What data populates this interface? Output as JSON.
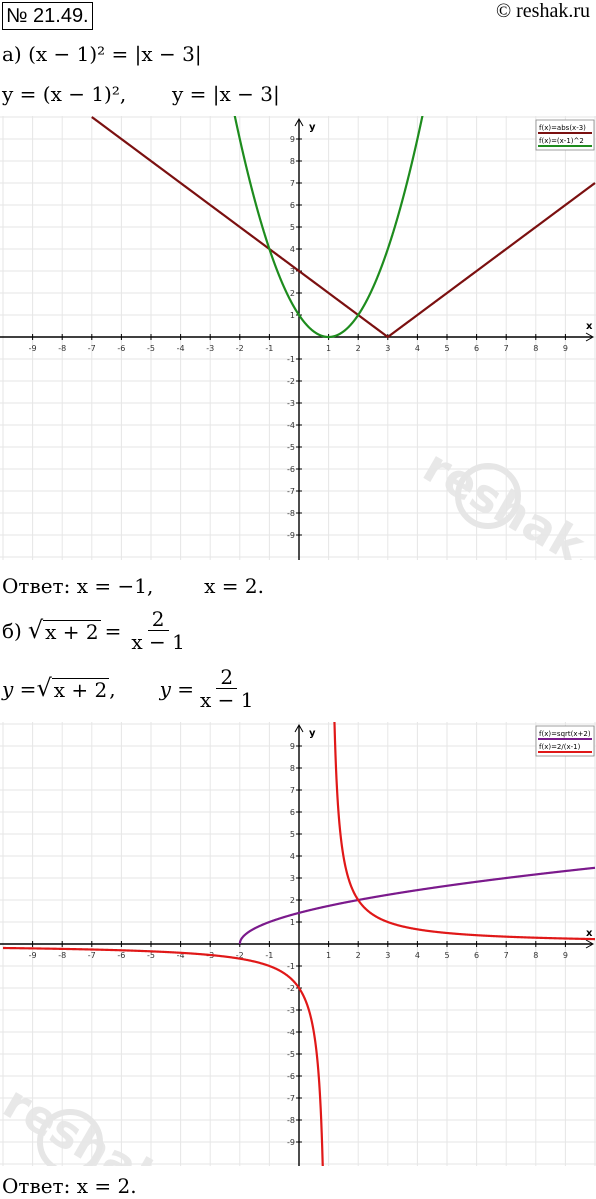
{
  "problem_number": "№ 21.49.",
  "site": "© reshak.ru",
  "watermark": "reshak.ru",
  "part_a": {
    "label": "а)",
    "equation": "(x − 1)² = |x − 3|",
    "functions_line": [
      "y = (x − 1)²,",
      "y = |x − 3|"
    ],
    "answer_label": "Ответ:",
    "answer": "x = −1,        x = 2."
  },
  "part_b": {
    "label": "б)",
    "eq_left": "x + 2",
    "eq_num": "2",
    "eq_den": "x − 1",
    "func1_radicand": "x + 2",
    "func2_num": "2",
    "func2_den": "x − 1",
    "answer_label": "Ответ:",
    "answer": "x = 2."
  },
  "chart_data": [
    {
      "type": "line",
      "title": "",
      "xlabel": "x",
      "ylabel": "y",
      "xlim": [
        -10,
        10
      ],
      "ylim": [
        -10,
        10
      ],
      "grid": true,
      "legend_position": "top-right",
      "x_ticks": [
        -9,
        -8,
        -7,
        -6,
        -5,
        -4,
        -3,
        -2,
        -1,
        1,
        2,
        3,
        4,
        5,
        6,
        7,
        8,
        9
      ],
      "y_ticks": [
        -9,
        -8,
        -7,
        -6,
        -5,
        -4,
        -3,
        -2,
        -1,
        1,
        2,
        3,
        4,
        5,
        6,
        7,
        8,
        9
      ],
      "series": [
        {
          "name": "f(x)=abs(x-3)",
          "color": "#7b1010",
          "expr": "abs(x-3)",
          "domain": [
            -7,
            10
          ]
        },
        {
          "name": "f(x)=(x-1)^2",
          "color": "#1e8c1e",
          "expr": "(x-1)^2",
          "domain": [
            -2.2,
            4.2
          ]
        }
      ]
    },
    {
      "type": "line",
      "title": "",
      "xlabel": "x",
      "ylabel": "y",
      "xlim": [
        -10,
        10
      ],
      "ylim": [
        -10,
        10
      ],
      "grid": true,
      "legend_position": "top-right",
      "x_ticks": [
        -9,
        -8,
        -7,
        -6,
        -5,
        -4,
        -3,
        -2,
        -1,
        1,
        2,
        3,
        4,
        5,
        6,
        7,
        8,
        9
      ],
      "y_ticks": [
        -9,
        -8,
        -7,
        -6,
        -5,
        -4,
        -3,
        -2,
        -1,
        1,
        2,
        3,
        4,
        5,
        6,
        7,
        8,
        9
      ],
      "series": [
        {
          "name": "f(x)=sqrt(x+2)",
          "color": "#7b1a8c",
          "expr": "sqrt(x+2)",
          "domain": [
            -2,
            10
          ]
        },
        {
          "name": "f(x)=2/(x-1)",
          "color": "#e01818",
          "expr": "2/(x-1)",
          "domain": [
            -10,
            10
          ]
        }
      ]
    }
  ]
}
